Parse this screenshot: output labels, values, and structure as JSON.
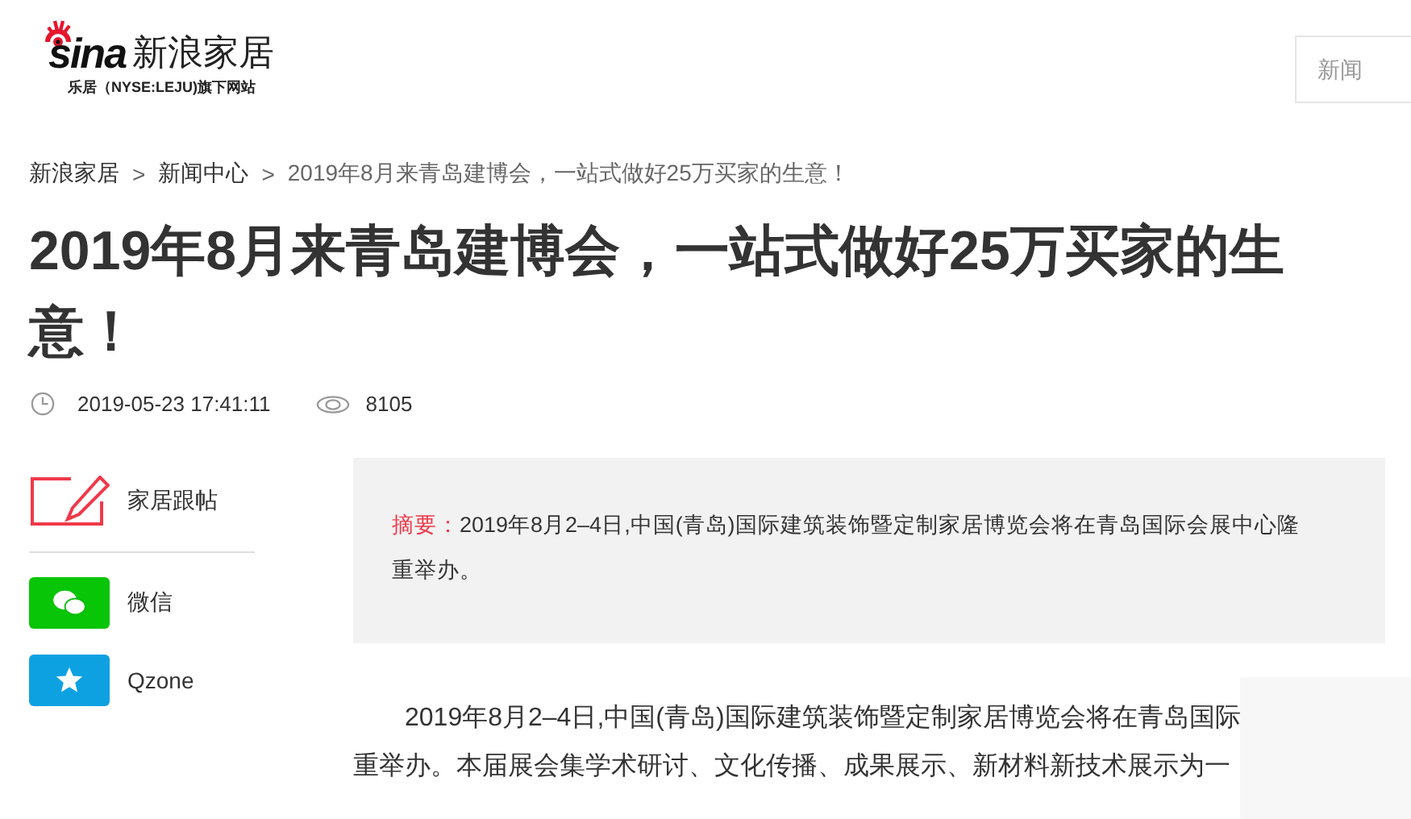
{
  "logo": {
    "brand": "sina",
    "site": "新浪家居",
    "tagline": "乐居（NYSE:LEJU)旗下网站"
  },
  "search": {
    "placeholder": "新闻"
  },
  "breadcrumb_separator": ">",
  "breadcrumb": [
    "新浪家居",
    "新闻中心",
    "2019年8月来青岛建博会，一站式做好25万买家的生意！"
  ],
  "title": "2019年8月来青岛建博会，一站式做好25万买家的生意！",
  "meta": {
    "datetime": "2019-05-23 17:41:11",
    "views": "8105"
  },
  "share": [
    {
      "kind": "comment",
      "label": "家居跟帖"
    },
    {
      "kind": "wechat",
      "label": "微信"
    },
    {
      "kind": "qzone",
      "label": "Qzone"
    }
  ],
  "summary": {
    "label": "摘要：",
    "text": "2019年8月2–4日,中国(青岛)国际建筑装饰暨定制家居博览会将在青岛国际会展中心隆重举办。"
  },
  "body_lines": [
    "2019年8月2–4日,中国(青岛)国际建筑装饰暨定制家居博览会将在青岛国际",
    "重举办。本届展会集学术研讨、文化传播、成果展示、新材料新技术展示为一"
  ]
}
